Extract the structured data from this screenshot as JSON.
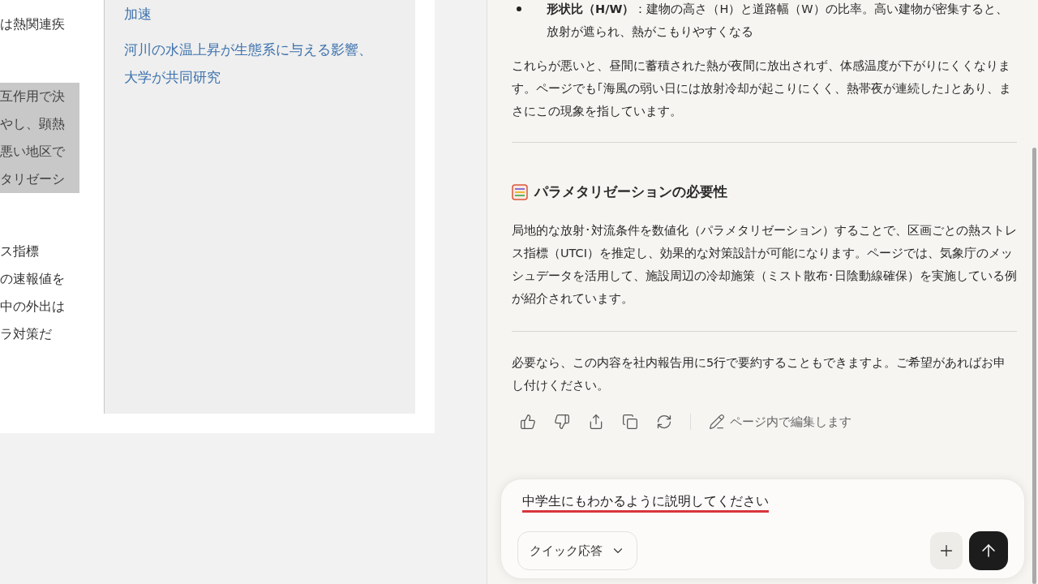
{
  "article": {
    "paragraphs": [
      {
        "lines": [
          {
            "text": "は熱関連疾",
            "highlighted": false
          }
        ]
      },
      {
        "lines": [
          {
            "text": "互作用で決",
            "highlighted": true
          },
          {
            "text": "やし、顕熱",
            "highlighted": true
          },
          {
            "text": "悪い地区で",
            "highlighted": true
          },
          {
            "text": "タリゼーシ",
            "highlighted": true
          }
        ]
      },
      {
        "lines": [
          {
            "text": "ス指標",
            "highlighted": false
          },
          {
            "text": "の速報値を",
            "highlighted": false
          },
          {
            "text": "中の外出は",
            "highlighted": false
          },
          {
            "text": "ラ対策だ",
            "highlighted": false
          }
        ]
      }
    ],
    "related_links": [
      "加速",
      "河川の水温上昇が生態系に与える影響、大学が共同研究"
    ]
  },
  "chat": {
    "bullets": [
      "**形状比（H/W）**：建物の高さ（H）と道路幅（W）の比率。高い建物が密集すると、放射が遮られ、熱がこもりやすくなる"
    ],
    "paragraph_1": "これらが悪いと、昼間に蓄積された熱が夜間に放出されず、体感温度が下がりにくくなります。ページでも｢海風の弱い日には放射冷却が起こりにくく、熱帯夜が連続した｣とあり、まさにこの現象を指しています。",
    "heading": "パラメタリゼーションの必要性",
    "paragraph_2": "局地的な放射･対流条件を数値化（パラメタリゼーション）することで、区画ごとの熱ストレス指標（UTCI）を推定し、効果的な対策設計が可能になります。ページでは、気象庁のメッシュデータを活用して、施設周辺の冷却施策（ミスト散布･日陰動線確保）を実施している例が紹介されています。",
    "paragraph_3": "必要なら、この内容を社内報告用に5行で要約することもできますよ。ご希望があればお申し付けください。",
    "edit_action": "ページ内で編集します",
    "input": {
      "value": "中学生にもわかるように説明してください",
      "underlined": true
    },
    "mode_dropdown": "クイック応答"
  }
}
